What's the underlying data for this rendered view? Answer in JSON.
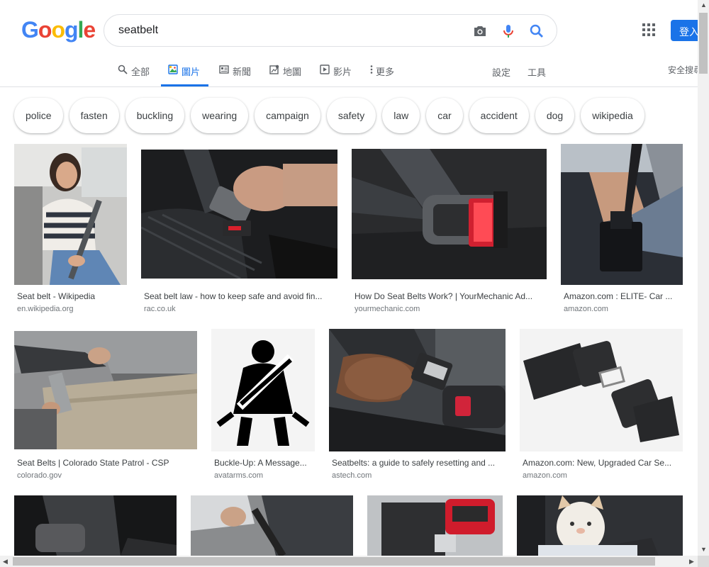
{
  "logo": {
    "letters": [
      "G",
      "o",
      "o",
      "g",
      "l",
      "e"
    ],
    "colors": [
      "#4285f4",
      "#ea4335",
      "#fbbc05",
      "#4285f4",
      "#34a853",
      "#ea4335"
    ]
  },
  "search": {
    "query": "seatbelt"
  },
  "header": {
    "signin_label": "登入",
    "safe_search_label": "安全搜尋"
  },
  "tabs": [
    {
      "label": "全部",
      "icon": "search-icon"
    },
    {
      "label": "圖片",
      "icon": "image-icon",
      "active": true
    },
    {
      "label": "新聞",
      "icon": "news-icon"
    },
    {
      "label": "地圖",
      "icon": "map-icon"
    },
    {
      "label": "影片",
      "icon": "video-icon"
    },
    {
      "label": "更多",
      "icon": "more-icon"
    }
  ],
  "tools": {
    "settings_label": "設定",
    "tools_label": "工具"
  },
  "chips": [
    "police",
    "fasten",
    "buckling",
    "wearing",
    "campaign",
    "safety",
    "law",
    "car",
    "accident",
    "dog",
    "wikipedia"
  ],
  "results": [
    {
      "caption": "Seat belt - Wikipedia",
      "domain": "en.wikipedia.org"
    },
    {
      "caption": "Seat belt law - how to keep safe and avoid fin...",
      "domain": "rac.co.uk"
    },
    {
      "caption": "How Do Seat Belts Work? | YourMechanic Ad...",
      "domain": "yourmechanic.com"
    },
    {
      "caption": "Amazon.com : ELITE- Car ...",
      "domain": "amazon.com"
    },
    {
      "caption": "Seat Belts | Colorado State Patrol - CSP",
      "domain": "colorado.gov"
    },
    {
      "caption": "Buckle-Up: A Message...",
      "domain": "avatarms.com"
    },
    {
      "caption": "Seatbelts: a guide to safely resetting and ...",
      "domain": "astech.com"
    },
    {
      "caption": "Amazon.com: New, Upgraded Car Se...",
      "domain": "amazon.com"
    }
  ],
  "colors": {
    "accent": "#1a73e8",
    "text_secondary": "#5f6368",
    "domain_text": "#70757a"
  }
}
